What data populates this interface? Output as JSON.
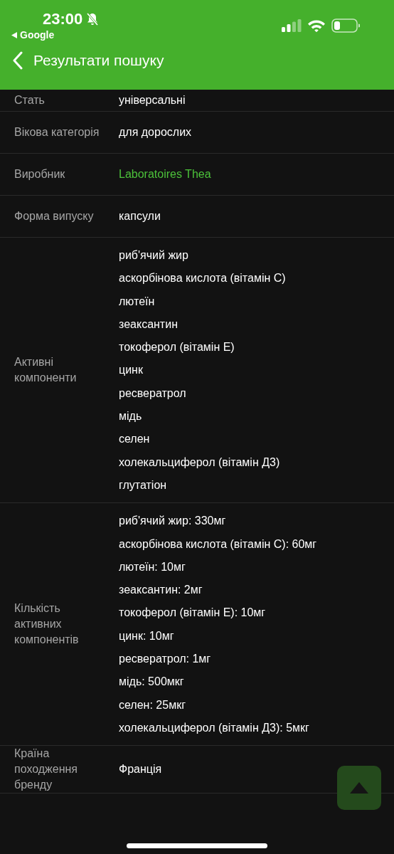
{
  "status_bar": {
    "time": "23:00",
    "back_app": "Google"
  },
  "header": {
    "title": "Результати пошуку"
  },
  "rows": [
    {
      "label": "Стать",
      "kind": "text",
      "value": "універсальні"
    },
    {
      "label": "Вікова категорія",
      "kind": "text",
      "value": "для дорослих"
    },
    {
      "label": "Виробник",
      "kind": "link",
      "value": "Laboratoires Thea"
    },
    {
      "label": "Форма випуску",
      "kind": "text",
      "value": "капсули"
    },
    {
      "label": "Активні\nкомпоненти",
      "kind": "list",
      "items": [
        "риб'ячий жир",
        "аскорбінова кислота (вітамін С)",
        "лютеїн",
        "зеаксантин",
        "токоферол (вітамін Е)",
        "цинк",
        "ресвератрол",
        "мідь",
        "селен",
        "холекальциферол (вітамін Д3)",
        "глутатіон"
      ]
    },
    {
      "label": "Кількість\nактивних\nкомпонентів",
      "kind": "list",
      "items": [
        "риб'ячий жир: 330мг",
        "аскорбінова кислота (вітамін С): 60мг",
        "лютеїн: 10мг",
        "зеаксантин: 2мг",
        "токоферол (вітамін Е): 10мг",
        "цинк: 10мг",
        "ресвератрол: 1мг",
        "мідь: 500мкг",
        "селен: 25мкг",
        "холекальциферол (вітамін Д3): 5мкг"
      ]
    },
    {
      "label": "Країна\nпоходження\nбренду",
      "kind": "text",
      "value": "Франція"
    }
  ]
}
